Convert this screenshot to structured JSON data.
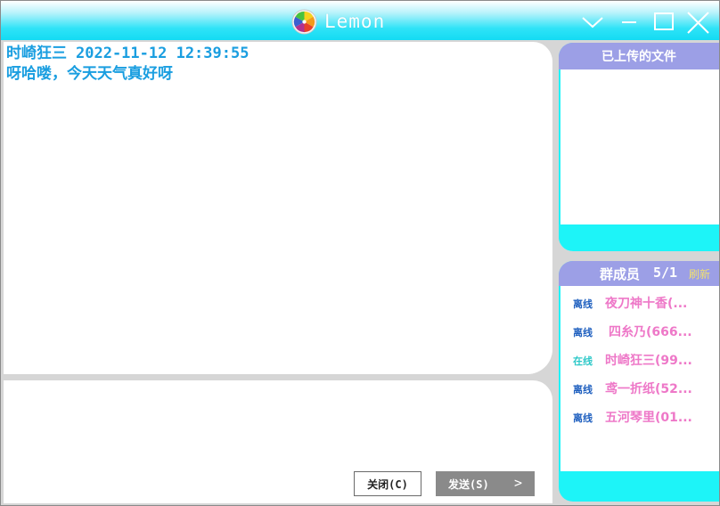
{
  "window": {
    "title": "Lemon",
    "accent_color": "#13dbf3",
    "header_color": "#9c9fe6",
    "controls": [
      "chevron-down-icon",
      "minimize-icon",
      "maximize-icon",
      "close-icon"
    ]
  },
  "chat": {
    "messages": [
      {
        "sender": "时崎狂三",
        "timestamp": "2022-11-12 12:39:55",
        "text": "呀哈喽，今天天气真好呀"
      }
    ],
    "input_value": "",
    "close_button_label": "关闭(C)",
    "send_button_label": "发送(S)",
    "send_arrow": ">"
  },
  "files_panel": {
    "title": "已上传的文件",
    "files": []
  },
  "members_panel": {
    "title": "群成员",
    "count": "5/1",
    "refresh_label": "刷新",
    "members": [
      {
        "status": "离线",
        "name": "夜刀神十香(..."
      },
      {
        "status": "离线",
        "name": "四糸乃(666..."
      },
      {
        "status": "在线",
        "name": "时崎狂三(99..."
      },
      {
        "status": "离线",
        "name": "鸢一折纸(52..."
      },
      {
        "status": "离线",
        "name": "五河琴里(01..."
      }
    ]
  }
}
